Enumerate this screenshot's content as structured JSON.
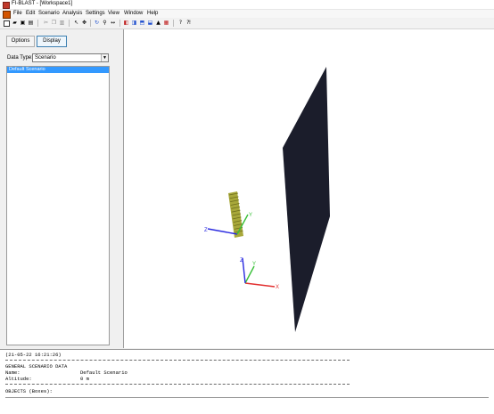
{
  "window": {
    "title": "FI-BLAST - [Workspace1]"
  },
  "menu": {
    "items": [
      "File",
      "Edit",
      "Scenario",
      "Analysis",
      "Settings",
      "View",
      "Window",
      "Help"
    ]
  },
  "left_panel": {
    "options_label": "Options",
    "display_label": "Display",
    "data_type_label": "Data Type:",
    "data_type_value": "Scenario",
    "list_items": [
      "Default Scenario"
    ]
  },
  "viewport": {
    "axis_labels": {
      "x": "X",
      "y": "Y",
      "z": "Z"
    },
    "colors": {
      "plate": "#1b1d2b",
      "object": "#a8a83a",
      "x_axis": "#e23030",
      "y_axis": "#38c038",
      "z_axis": "#2a2ae0"
    }
  },
  "console": {
    "timestamp": "(21-05-22 16:21:26)",
    "section_title": "GENERAL SCENARIO DATA",
    "name_label": "Name:",
    "name_value": "Default Scenario",
    "altitude_label": "Altitude:",
    "altitude_value": "0 m",
    "objects_label": "OBJECTS (Boxes):"
  },
  "icons": [
    "new-file-icon",
    "open-icon",
    "save-icon",
    "print-icon",
    "cut-icon",
    "copy-icon",
    "paste-icon",
    "select-icon",
    "move-icon",
    "rotate-icon",
    "zoom-icon",
    "pan-icon",
    "view-front-icon",
    "view-back-icon",
    "view-top-icon",
    "view-side-icon",
    "shape-icon",
    "grid-icon",
    "help-icon",
    "context-help-icon"
  ]
}
